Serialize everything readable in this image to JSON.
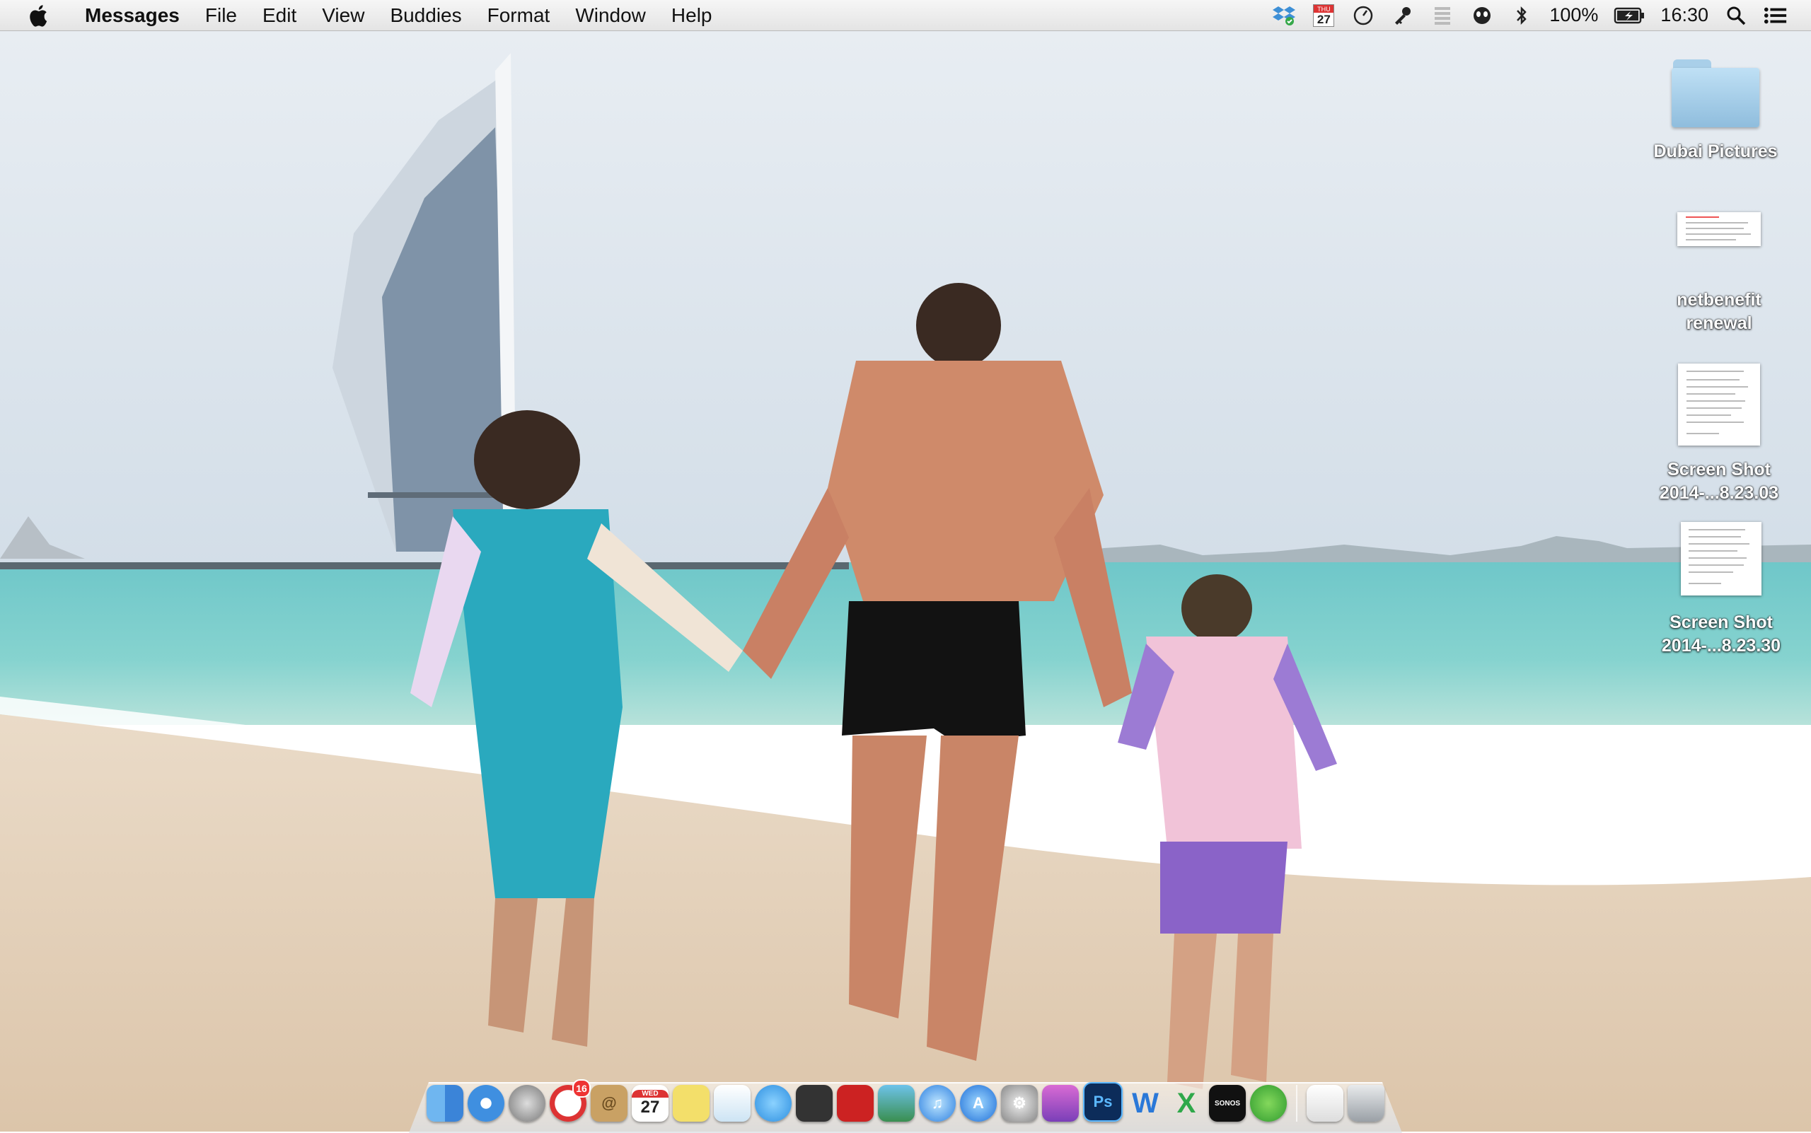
{
  "menubar": {
    "app_name": "Messages",
    "items": [
      "File",
      "Edit",
      "View",
      "Buddies",
      "Format",
      "Window",
      "Help"
    ],
    "status": {
      "calendar_day_abbrev": "THU",
      "calendar_day_number": "27",
      "battery": "100%",
      "time": "16:30"
    }
  },
  "desktop": {
    "icons": [
      {
        "label": "Dubai Pictures",
        "kind": "folder"
      },
      {
        "label": "netbenefit renewal",
        "kind": "document"
      },
      {
        "label": "Screen Shot 2014-...8.23.03",
        "kind": "screenshot"
      },
      {
        "label": "Screen Shot 2014-...8.23.30",
        "kind": "screenshot"
      }
    ]
  },
  "dock": {
    "mail_badge": "16",
    "calendar_day_abbrev": "WED",
    "calendar_day_number": "27",
    "photoshop_label": "Ps",
    "word_label": "W",
    "excel_label": "X",
    "sonos_label": "SONOS"
  },
  "colors": {
    "sky": "#dde6ee",
    "sea": "#57c3c4",
    "sand": "#e6d3bd",
    "menubar": "#ececec"
  }
}
